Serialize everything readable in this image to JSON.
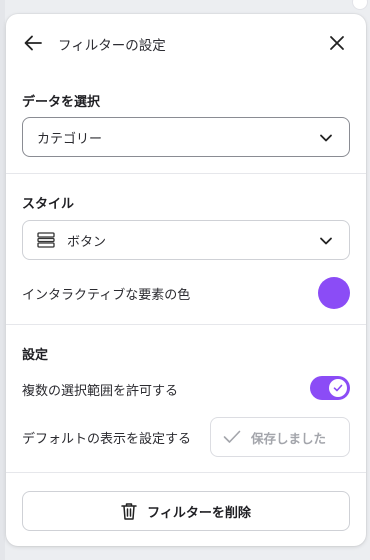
{
  "header": {
    "title": "フィルターの設定",
    "back_icon": "arrow-left-icon",
    "close_icon": "close-icon"
  },
  "data_section": {
    "label": "データを選択",
    "select_value": "カテゴリー"
  },
  "style_section": {
    "label": "スタイル",
    "select_value": "ボタン",
    "select_icon": "rows-icon",
    "interactive_color_label": "インタラクティブな要素の色",
    "interactive_color": "#8b4cf6"
  },
  "settings_section": {
    "label": "設定",
    "multi_select_label": "複数の選択範囲を許可する",
    "multi_select_enabled": true,
    "default_display_label": "デフォルトの表示を設定する",
    "saved_button_label": "保存しました"
  },
  "footer": {
    "delete_button_label": "フィルターを削除",
    "delete_icon": "trash-icon"
  },
  "colors": {
    "accent": "#8b4cf6",
    "border": "#cfd1d6",
    "disabled_text": "#a3a5ab"
  }
}
